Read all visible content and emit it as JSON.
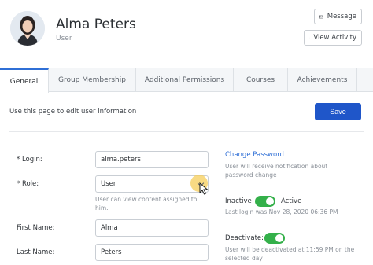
{
  "profile": {
    "name": "Alma Peters",
    "role": "User",
    "message_label": "Message",
    "activity_label": "View Activity"
  },
  "tabs": [
    {
      "label": "General",
      "active": true
    },
    {
      "label": "Group Membership",
      "active": false
    },
    {
      "label": "Additional Permissions",
      "active": false
    },
    {
      "label": "Courses",
      "active": false
    },
    {
      "label": "Achievements",
      "active": false
    }
  ],
  "page": {
    "intro": "Use this page to edit user information",
    "save_label": "Save"
  },
  "form": {
    "login_label": "* Login:",
    "login_value": "alma.peters",
    "role_label": "* Role:",
    "role_value": "User",
    "role_help": "User can view content assigned to him.",
    "first_name_label": "First Name:",
    "first_name_value": "Alma",
    "last_name_label": "Last Name:",
    "last_name_value": "Peters"
  },
  "side": {
    "change_password": "Change Password",
    "password_note": "User will receive notification about password change",
    "inactive_label": "Inactive",
    "active_label": "Active",
    "last_login": "Last login was Nov 28, 2020 06:36 PM",
    "deactivate_label": "Deactivate:",
    "deactivate_note": "User will be deactivated at 11:59 PM on the selected day",
    "status_active": true,
    "deactivate_on": true
  },
  "colors": {
    "accent": "#1f56c9",
    "link": "#2f6fd6",
    "toggle_on": "#34b04a",
    "tab_active_border": "#2f6fd6"
  }
}
